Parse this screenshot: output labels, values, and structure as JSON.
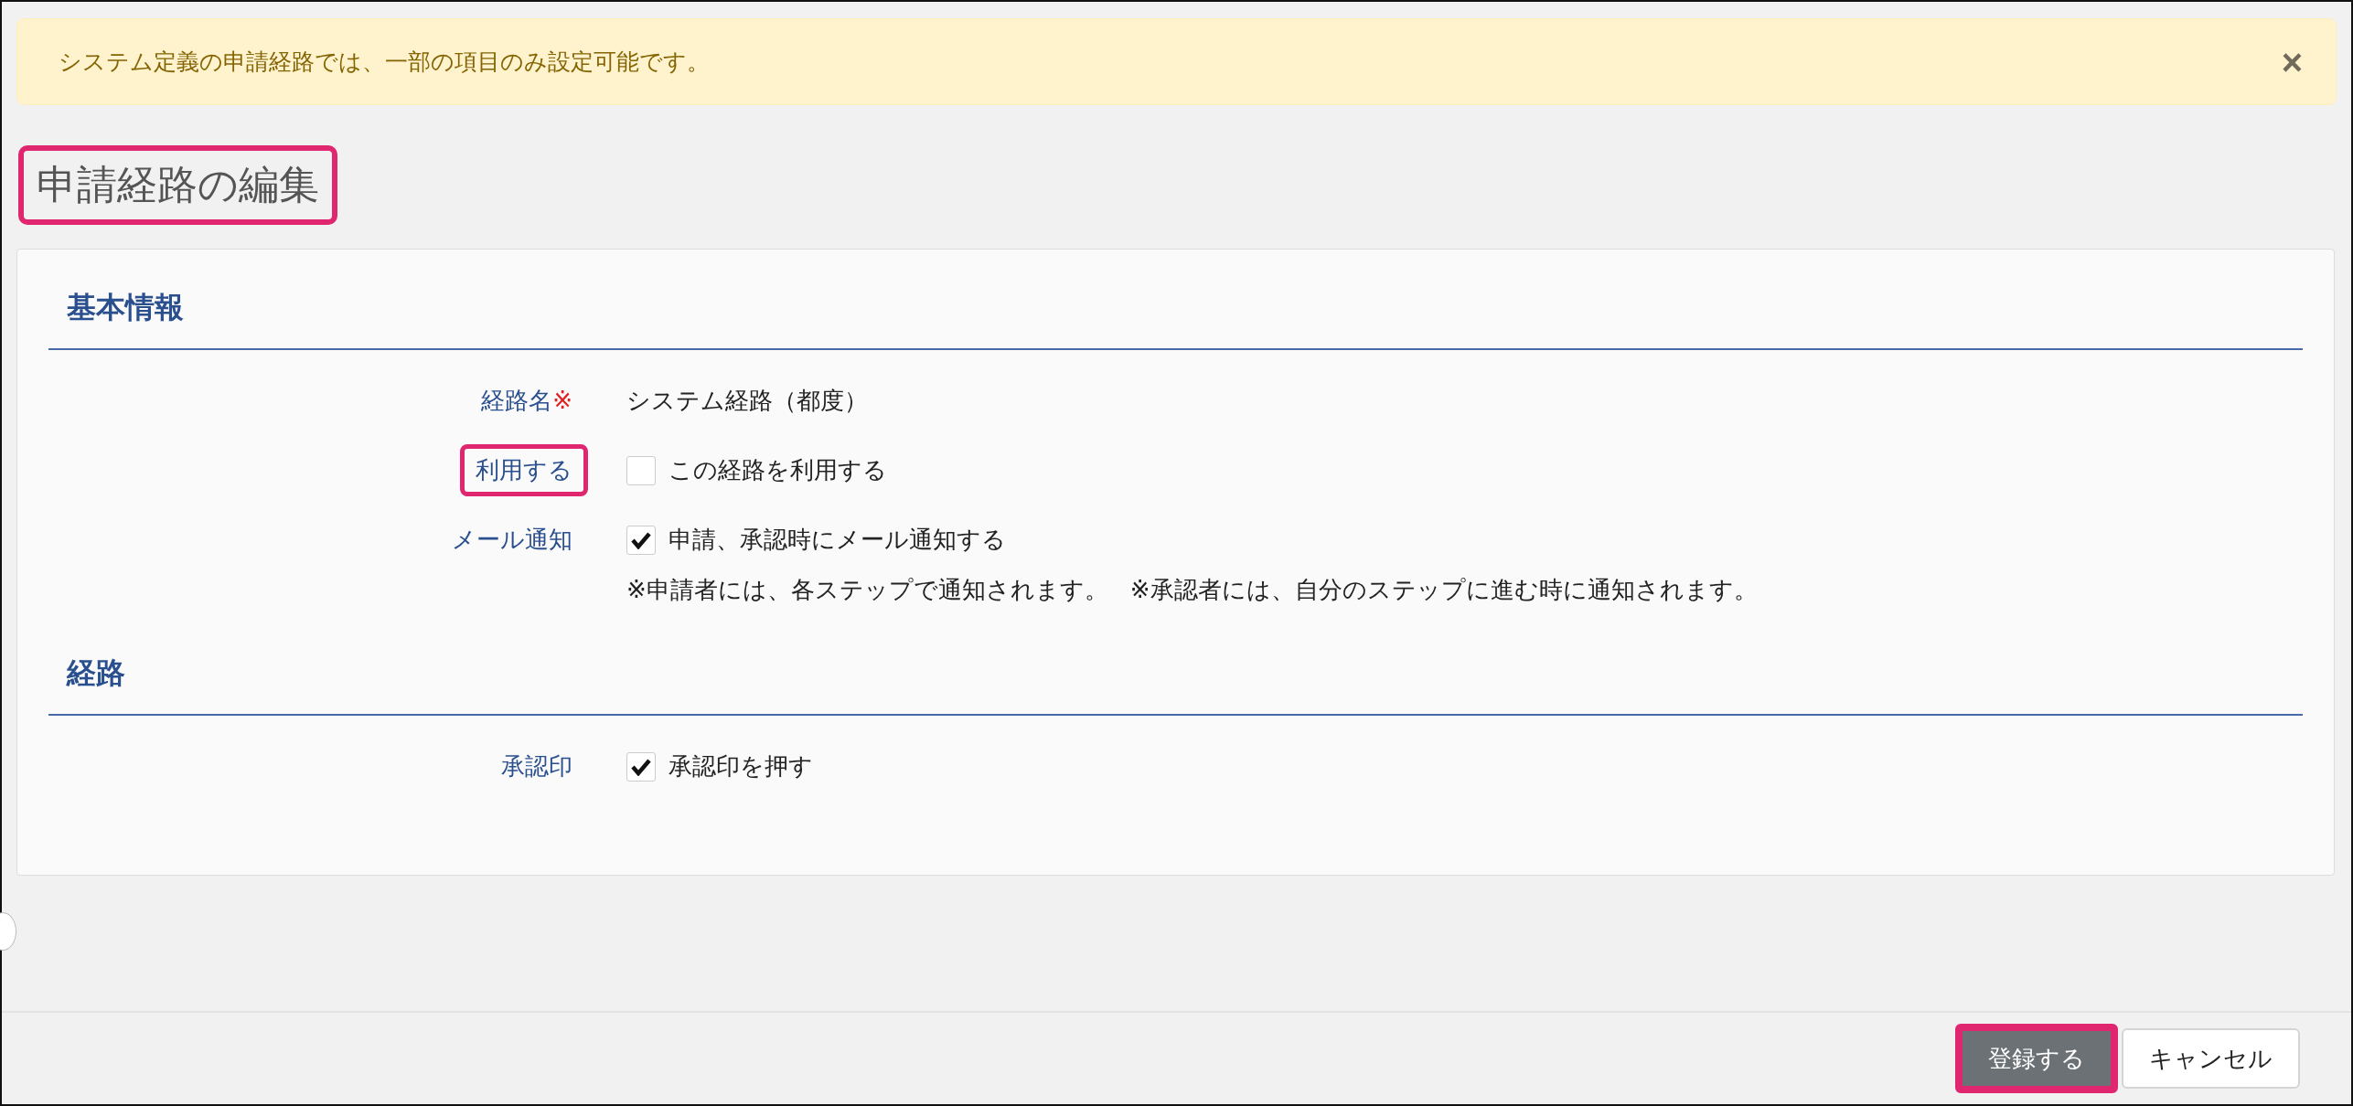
{
  "alert": {
    "message": "システム定義の申請経路では、一部の項目のみ設定可能です。",
    "close": "×"
  },
  "page_title": {
    "text": "申請経路の編集",
    "highlighted": true
  },
  "sections": [
    {
      "heading": "基本情報",
      "fields": [
        {
          "kind": "text",
          "label": "経路名",
          "required_mark": "※",
          "highlighted": false,
          "value": "システム経路（都度）"
        },
        {
          "kind": "checkbox",
          "label": "利用する",
          "highlighted": true,
          "option": "この経路を利用する",
          "checked": false
        },
        {
          "kind": "checkbox",
          "label": "メール通知",
          "highlighted": false,
          "option": "申請、承認時にメール通知する",
          "checked": true,
          "notes": [
            "※申請者には、各ステップで通知されます。",
            "※承認者には、自分のステップに進む時に通知されます。"
          ]
        }
      ]
    },
    {
      "heading": "経路",
      "fields": [
        {
          "kind": "checkbox",
          "label": "承認印",
          "highlighted": false,
          "option": "承認印を押す",
          "checked": true
        }
      ]
    }
  ],
  "buttons": [
    {
      "kind": "primary",
      "label": "登録する",
      "highlighted": true
    },
    {
      "kind": "secondary",
      "label": "キャンセル",
      "highlighted": false
    }
  ]
}
